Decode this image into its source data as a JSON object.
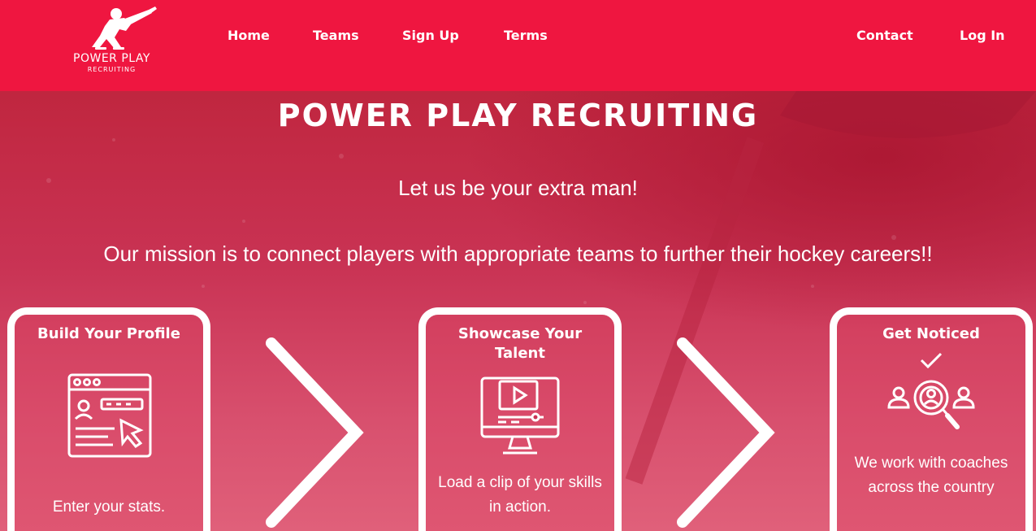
{
  "brand": {
    "name": "POWER PLAY",
    "sub": "RECRUITING"
  },
  "nav": {
    "left": [
      "Home",
      "Teams",
      "Sign Up",
      "Terms"
    ],
    "right": [
      "Contact",
      "Log In"
    ]
  },
  "hero": {
    "title": "POWER PLAY RECRUITING",
    "tagline": "Let us be your extra man!",
    "mission": "Our mission is to connect players with appropriate teams to further their hockey careers!!"
  },
  "cards": [
    {
      "title": "Build Your Profile",
      "text": "Enter your stats.",
      "icon": "profile-browser-icon"
    },
    {
      "title": "Showcase Your Talent",
      "text": "Load a clip of your skills in action.",
      "icon": "video-monitor-icon"
    },
    {
      "title": "Get Noticed",
      "text": "We work with coaches across the country",
      "icon": "recruit-search-icon"
    }
  ],
  "colors": {
    "navbar": "#ef1640",
    "hero": "#c93354",
    "text": "#ffffff"
  }
}
